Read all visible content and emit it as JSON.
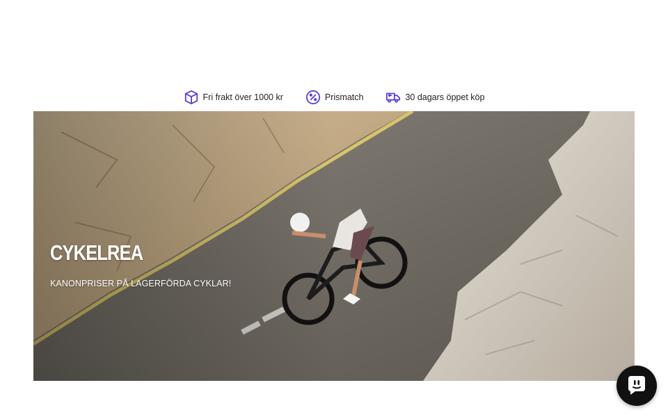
{
  "usp": {
    "items": [
      {
        "icon": "box-icon",
        "label": "Fri frakt över 1000 kr"
      },
      {
        "icon": "percent-badge-icon",
        "label": "Prismatch"
      },
      {
        "icon": "return-truck-icon",
        "label": "30 dagars öppet köp"
      }
    ]
  },
  "hero": {
    "title": "CYKELREA",
    "subtitle": "KANONPRISER PÅ LAGERFÖRDA CYKLAR!"
  },
  "chat": {
    "icon": "chat-bubble-icon"
  },
  "colors": {
    "accent": "#5b3fd6",
    "text": "#222222",
    "background": "#ffffff"
  }
}
